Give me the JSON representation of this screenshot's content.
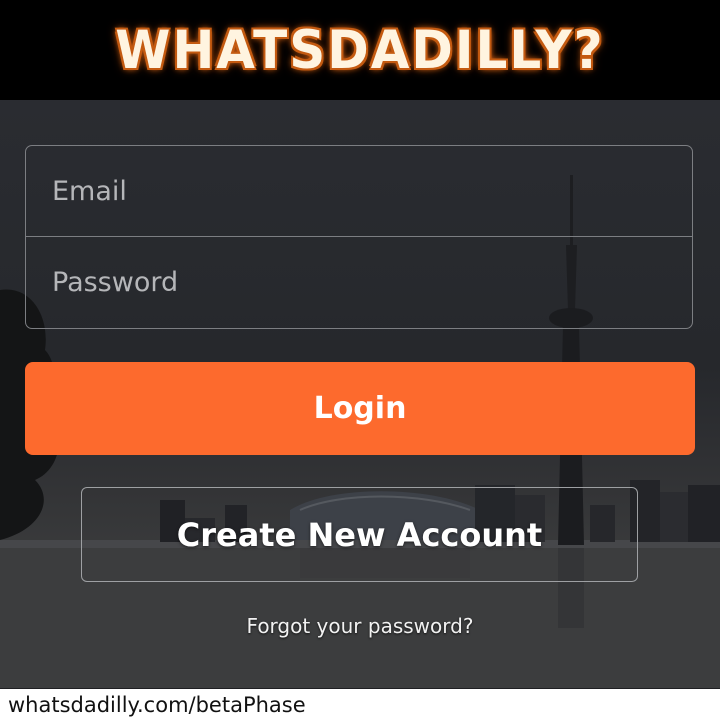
{
  "header": {
    "logo_text": "WHATSDADILLY?"
  },
  "login_form": {
    "email_placeholder": "Email",
    "password_placeholder": "Password",
    "login_label": "Login",
    "create_account_label": "Create New Account",
    "forgot_password_label": "Forgot your password?"
  },
  "footer": {
    "url_text": "whatsdadilly.com/betaPhase"
  },
  "colors": {
    "accent": "#fd6a2d",
    "header_bg": "#000000",
    "footer_bg": "#ffffff"
  }
}
